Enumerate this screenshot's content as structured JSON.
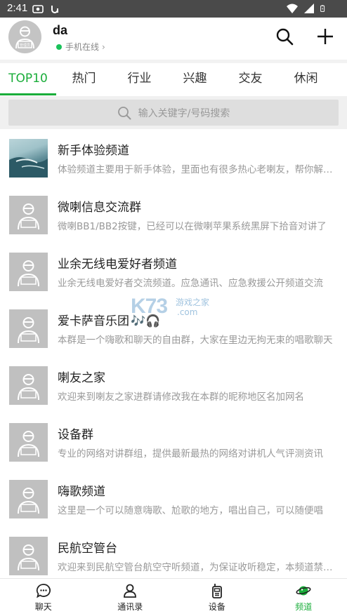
{
  "status_bar": {
    "time": "2:41",
    "left_icons": [
      "radio-icon",
      "sync-icon"
    ],
    "right_icons": [
      "wifi-icon",
      "signal-icon",
      "battery-icon"
    ]
  },
  "header": {
    "username": "da",
    "online_status": "手机在线",
    "online_chevron": "›",
    "avatar_label": "管理员",
    "status_color": "#19c25a"
  },
  "tabs": [
    {
      "label": "TOP10",
      "active": true
    },
    {
      "label": "热门",
      "active": false
    },
    {
      "label": "行业",
      "active": false
    },
    {
      "label": "兴趣",
      "active": false
    },
    {
      "label": "交友",
      "active": false
    },
    {
      "label": "休闲",
      "active": false
    }
  ],
  "accent_color": "#1aad3a",
  "search": {
    "placeholder": "输入关键字/号码搜索"
  },
  "channels": [
    {
      "name": "新手体验频道",
      "desc": "体验频道主要用于新手体验，里面也有很多热心老喇友，帮你解答各种问题",
      "avatar": "sea-photo"
    },
    {
      "name": "微喇信息交流群",
      "desc": "微喇BB1/BB2按键，已经可以在微喇苹果系统黑屏下拾音对讲了",
      "avatar": "default"
    },
    {
      "name": "业余无线电爱好者频道",
      "desc": "业余无线电爱好者交流频道。应急通讯、应急救援公开频道交流",
      "avatar": "default"
    },
    {
      "name": "爱卡萨音乐团",
      "desc": "本群是一个嗨歌和聊天的自由群，大家在里边无拘无束的唱歌聊天",
      "avatar": "default",
      "emoji": "🎶🎧"
    },
    {
      "name": "喇友之家",
      "desc": "欢迎来到喇友之家进群请修改我在本群的昵称地区名加网名",
      "avatar": "default"
    },
    {
      "name": "设备群",
      "desc": "专业的网络对讲群组，提供最新最热的网络对讲机人气评测资讯",
      "avatar": "default"
    },
    {
      "name": "嗨歌频道",
      "desc": "这里是一个可以随意嗨歌、尬歌的地方，唱出自己，可以随便唱",
      "avatar": "default"
    },
    {
      "name": "民航空管台",
      "desc": "欢迎来到民航空管台航空守听频道，为保证收听稳定，本频道禁止发言",
      "avatar": "default"
    }
  ],
  "watermark": {
    "main": "K73",
    "sub": "游戏之家",
    "domain": ".com"
  },
  "bottom_nav": [
    {
      "label": "聊天",
      "icon": "chat-bubble-icon",
      "active": false
    },
    {
      "label": "通讯录",
      "icon": "contacts-icon",
      "active": false
    },
    {
      "label": "设备",
      "icon": "walkie-talkie-icon",
      "active": false
    },
    {
      "label": "频道",
      "icon": "planet-icon",
      "active": true
    }
  ]
}
